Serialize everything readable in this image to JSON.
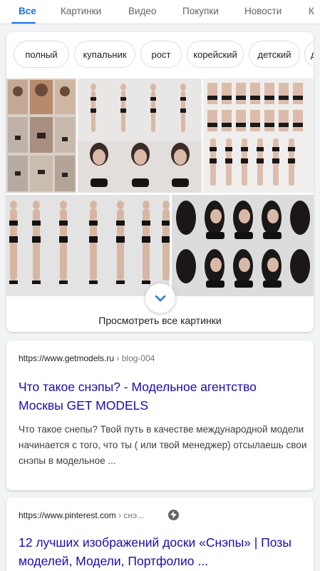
{
  "tabs": [
    {
      "label": "Все",
      "active": true
    },
    {
      "label": "Картинки",
      "active": false
    },
    {
      "label": "Видео",
      "active": false
    },
    {
      "label": "Покупки",
      "active": false
    },
    {
      "label": "Новости",
      "active": false
    },
    {
      "label": "К",
      "active": false
    }
  ],
  "chips": [
    "полный",
    "купальник",
    "рост",
    "корейский",
    "детский",
    "д"
  ],
  "images": {
    "view_all_label": "Просмотреть все картинки",
    "expand_icon": "chevron-down-icon"
  },
  "results": [
    {
      "url": "https://www.getmodels.ru",
      "crumb": "› blog-004",
      "title": "Что такое снэпы? - Модельное агентство Москвы GET MODELS",
      "snippet": "Что такое снепы? Твой путь в качестве международной модели начинается с того, что ты ( или твой менеджер) отсылаешь свои снэпы в модельное ..."
    },
    {
      "url": "https://www.pinterest.com",
      "crumb": "› снэ...",
      "title": "12 лучших изображений доски «Снэпы» | Позы моделей, Модели, Портфолио ...",
      "icon": "amp-lightning-icon"
    }
  ],
  "colors": {
    "accent": "#1a73e8",
    "link": "#1a0dab",
    "background": "#f1f3f4"
  }
}
